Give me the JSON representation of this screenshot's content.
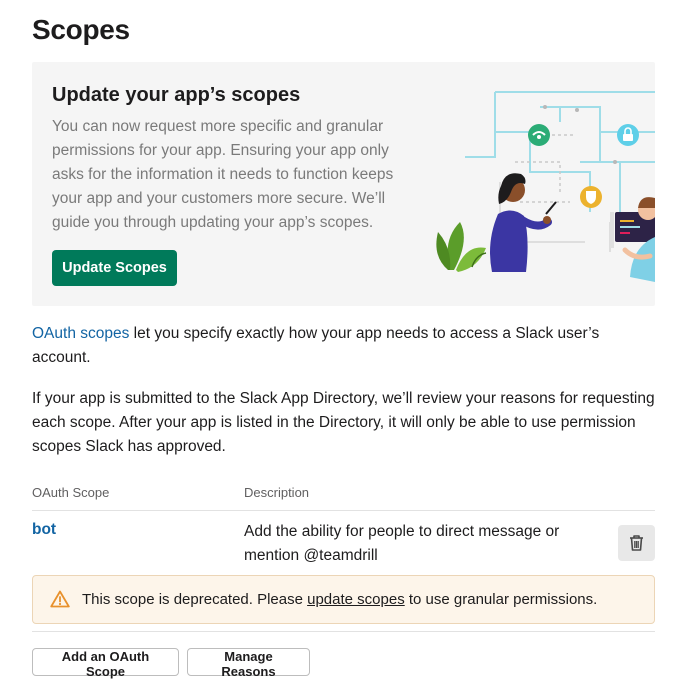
{
  "page": {
    "title": "Scopes"
  },
  "banner": {
    "title": "Update your app’s scopes",
    "text": "You can now request more specific and granular permissions for your app. Ensuring your app only asks for the information it needs to function keeps your app and your customers more secure. We’ll guide you through updating your app’s scopes.",
    "button_label": "Update Scopes"
  },
  "intro": {
    "link_text": "OAuth scopes",
    "text_after_link": " let you specify exactly how your app needs to access a Slack user’s account.",
    "paragraph2": "If your app is submitted to the Slack App Directory, we’ll review your reasons for requesting each scope. After your app is listed in the Directory, it will only be able to use permission scopes Slack has approved."
  },
  "table": {
    "headers": {
      "scope": "OAuth Scope",
      "description": "Description"
    },
    "rows": [
      {
        "scope": "bot",
        "description": "Add the ability for people to direct message or mention @teamdrill"
      }
    ]
  },
  "warning": {
    "text_before": "This scope is deprecated. Please ",
    "link_text": "update scopes",
    "text_after": " to use granular permissions."
  },
  "actions": {
    "add_label": "Add an OAuth Scope",
    "manage_label": "Manage Reasons"
  },
  "colors": {
    "primary_button": "#007a5a",
    "link": "#1264a3",
    "warning_bg": "#fdf5ea",
    "warning_icon": "#e8912d"
  },
  "icons": {
    "trash": "trash-icon",
    "warning": "warning-icon"
  }
}
